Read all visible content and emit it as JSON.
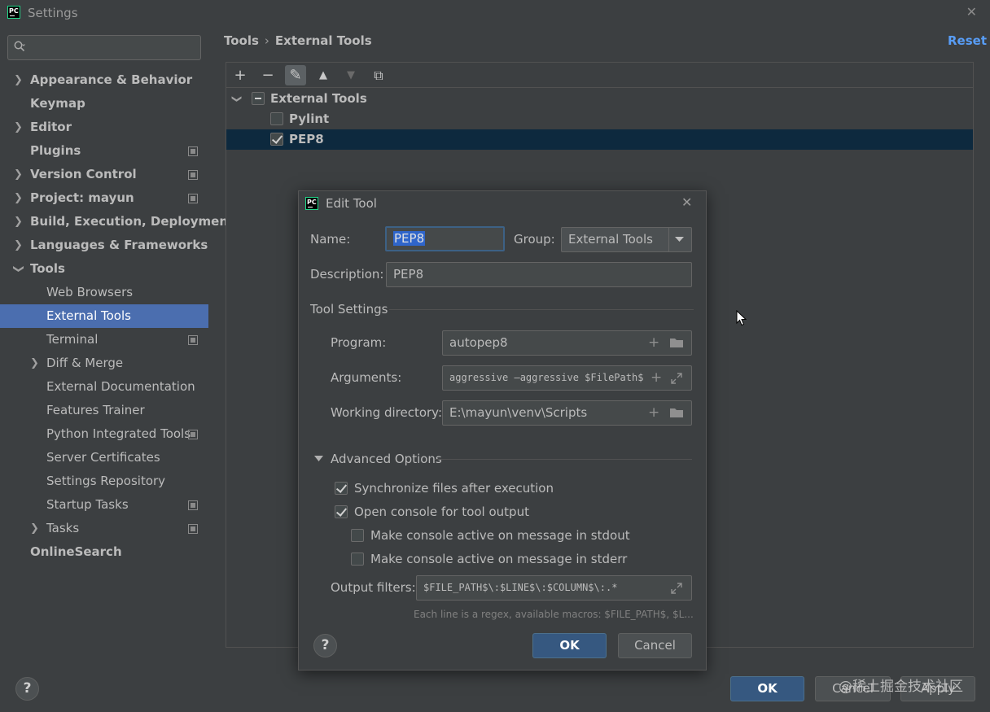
{
  "window": {
    "title": "Settings",
    "close": "✕",
    "app_icon_text": "PC"
  },
  "search": {
    "placeholder": "",
    "value": ""
  },
  "sidebar": {
    "items": [
      {
        "label": "Appearance & Behavior"
      },
      {
        "label": "Keymap"
      },
      {
        "label": "Editor"
      },
      {
        "label": "Plugins"
      },
      {
        "label": "Version Control"
      },
      {
        "label": "Project: mayun"
      },
      {
        "label": "Build, Execution, Deployment"
      },
      {
        "label": "Languages & Frameworks"
      },
      {
        "label": "Tools"
      },
      {
        "label": "Web Browsers"
      },
      {
        "label": "External Tools"
      },
      {
        "label": "Terminal"
      },
      {
        "label": "Diff & Merge"
      },
      {
        "label": "External Documentation"
      },
      {
        "label": "Features Trainer"
      },
      {
        "label": "Python Integrated Tools"
      },
      {
        "label": "Server Certificates"
      },
      {
        "label": "Settings Repository"
      },
      {
        "label": "Startup Tasks"
      },
      {
        "label": "Tasks"
      },
      {
        "label": "OnlineSearch"
      }
    ]
  },
  "breadcrumb": {
    "parent": "Tools",
    "separator": "›",
    "current": "External Tools"
  },
  "reset_label": "Reset",
  "toolbar": {
    "add": "+",
    "remove": "−",
    "edit": "✎",
    "up": "▲",
    "down": "▼",
    "copy": "⧉"
  },
  "tree": {
    "group_label": "External Tools",
    "tools": [
      {
        "label": "Pylint",
        "checked": false
      },
      {
        "label": "PEP8",
        "checked": true
      }
    ]
  },
  "footer": {
    "help": "?",
    "ok": "OK",
    "cancel": "Cancel",
    "apply": "Apply"
  },
  "dialog": {
    "title": "Edit Tool",
    "close": "✕",
    "name_label": "Name:",
    "name_value": "PEP8",
    "group_label": "Group:",
    "group_value": "External Tools",
    "description_label": "Description:",
    "description_value": "PEP8",
    "tool_settings_label": "Tool Settings",
    "program_label": "Program:",
    "program_value": "autopep8",
    "arguments_label": "Arguments:",
    "arguments_value": "aggressive —aggressive $FilePath$",
    "workdir_label": "Working directory:",
    "workdir_value": "E:\\mayun\\venv\\Scripts",
    "advanced_label": "Advanced Options",
    "options": [
      {
        "label": "Synchronize files after execution",
        "checked": true
      },
      {
        "label": "Open console for tool output",
        "checked": true
      },
      {
        "label": "Make console active on message in stdout",
        "checked": false
      },
      {
        "label": "Make console active on message in stderr",
        "checked": false
      }
    ],
    "output_filters_label": "Output filters:",
    "output_filters_value": "$FILE_PATH$\\:$LINE$\\:$COLUMN$\\:.*",
    "hint": "Each line is a regex, available macros: $FILE_PATH$, $L...",
    "help": "?",
    "ok": "OK",
    "cancel": "Cancel"
  },
  "watermark": "@稀土掘金技术社区",
  "colors": {
    "accent": "#4b6eaf",
    "primary_button": "#365880",
    "link": "#589df6",
    "selection": "#0d293e"
  }
}
